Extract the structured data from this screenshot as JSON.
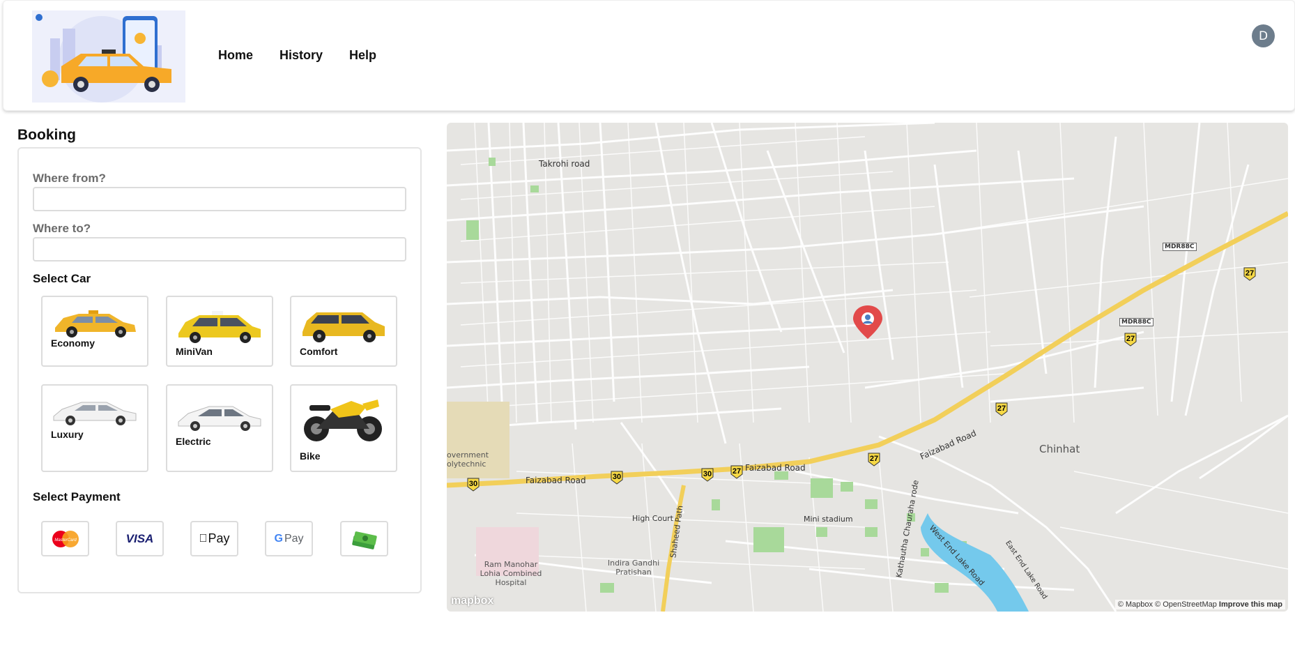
{
  "header": {
    "nav": [
      {
        "label": "Home"
      },
      {
        "label": "History"
      },
      {
        "label": "Help"
      }
    ],
    "avatar_initial": "D"
  },
  "booking": {
    "title": "Booking",
    "from_label": "Where from?",
    "from_value": "",
    "to_label": "Where to?",
    "to_value": "",
    "select_car_label": "Select Car",
    "cars": [
      {
        "name": "Economy",
        "icon": "taxi-car-icon"
      },
      {
        "name": "MiniVan",
        "icon": "minivan-car-icon"
      },
      {
        "name": "Comfort",
        "icon": "suv-car-icon"
      },
      {
        "name": "Luxury",
        "icon": "luxury-car-icon"
      },
      {
        "name": "Electric",
        "icon": "electric-car-icon"
      },
      {
        "name": "Bike",
        "icon": "motorbike-icon"
      }
    ],
    "select_payment_label": "Select Payment",
    "payments": [
      {
        "name": "MasterCard",
        "icon": "mastercard-icon",
        "text": "MasterCard"
      },
      {
        "name": "Visa",
        "icon": "visa-icon",
        "text": "VISA"
      },
      {
        "name": "Apple Pay",
        "icon": "apple-pay-icon",
        "text": "Pay"
      },
      {
        "name": "Google Pay",
        "icon": "google-pay-icon",
        "text": "Pay"
      },
      {
        "name": "Cash",
        "icon": "cash-icon",
        "text": ""
      }
    ]
  },
  "map": {
    "labels": {
      "takrohi": "Takrohi road",
      "faizabad1": "Faizabad Road",
      "faizabad2": "Faizabad Road",
      "faizabad3": "Faizabad Road",
      "chinhat": "Chinhat",
      "high_court": "High Court",
      "mini_stadium": "Mini stadium",
      "indira": "Indira Gandhi Pratishan",
      "ram_manohar": "Ram Manohar Lohia Combined Hospital",
      "govt_poly": "overnment olytechnic",
      "shaheed_path": "Shaheed Path",
      "kathautha": "Kathautha Chauraha rode",
      "west_end": "West End Lake Road",
      "east_end": "East End Lake Road",
      "mdr88c_1": "MDR88C",
      "mdr88c_2": "MDR88C",
      "route_27": "27",
      "route_30": "30"
    },
    "attribution": "© Mapbox © OpenStreetMap",
    "improve": "Improve this map",
    "logo_text": "mapbox"
  }
}
